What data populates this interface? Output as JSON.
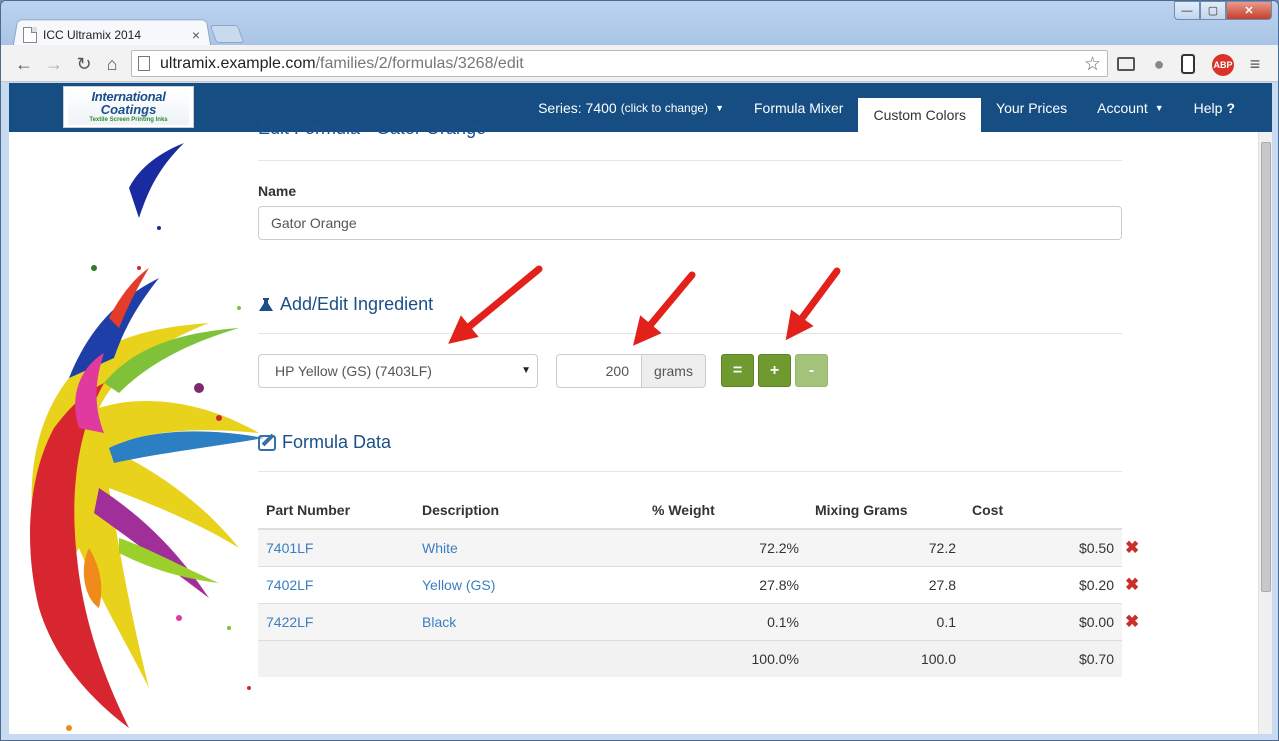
{
  "browser": {
    "tab_title": "ICC Ultramix 2014",
    "url_host": "ultramix.example.com",
    "url_path": "/families/2/formulas/3268/edit",
    "window_controls": {
      "minimize": "—",
      "maximize": "▢",
      "close": "✕"
    }
  },
  "brand": {
    "line1": "International",
    "line2": "Coatings",
    "tagline": "Textile Screen Printing Inks"
  },
  "nav": {
    "series_label": "Series: 7400",
    "series_hint": "(click to change)",
    "formula_mixer": "Formula Mixer",
    "custom_colors": "Custom Colors",
    "your_prices": "Your Prices",
    "account": "Account",
    "help": "Help",
    "help_icon": "?"
  },
  "form": {
    "heading": "Edit Formula - Gator Orange",
    "name_label": "Name",
    "name_value": "Gator Orange"
  },
  "ingredient": {
    "heading": "Add/Edit Ingredient",
    "selected": "HP Yellow (GS) (7403LF)",
    "quantity": "200",
    "unit": "grams",
    "btn_equal": "=",
    "btn_plus": "+",
    "btn_minus": "-"
  },
  "formula_data": {
    "heading": "Formula Data",
    "columns": [
      "Part Number",
      "Description",
      "% Weight",
      "Mixing Grams",
      "Cost"
    ],
    "rows": [
      {
        "part": "7401LF",
        "description": "White",
        "weight": "72.2%",
        "grams": "72.2",
        "cost": "$0.50"
      },
      {
        "part": "7402LF",
        "description": "Yellow (GS)",
        "weight": "27.8%",
        "grams": "27.8",
        "cost": "$0.20"
      },
      {
        "part": "7422LF",
        "description": "Black",
        "weight": "0.1%",
        "grams": "0.1",
        "cost": "$0.00"
      }
    ],
    "totals": {
      "weight": "100.0%",
      "grams": "100.0",
      "cost": "$0.70"
    },
    "delete_glyph": "✖"
  },
  "colors": {
    "navbar": "#164d82",
    "accent": "#1b4f8a",
    "link": "#3a7fc0",
    "green_button": "#6e9a2f",
    "delete": "#c9302c",
    "arrow": "#e3211b"
  }
}
